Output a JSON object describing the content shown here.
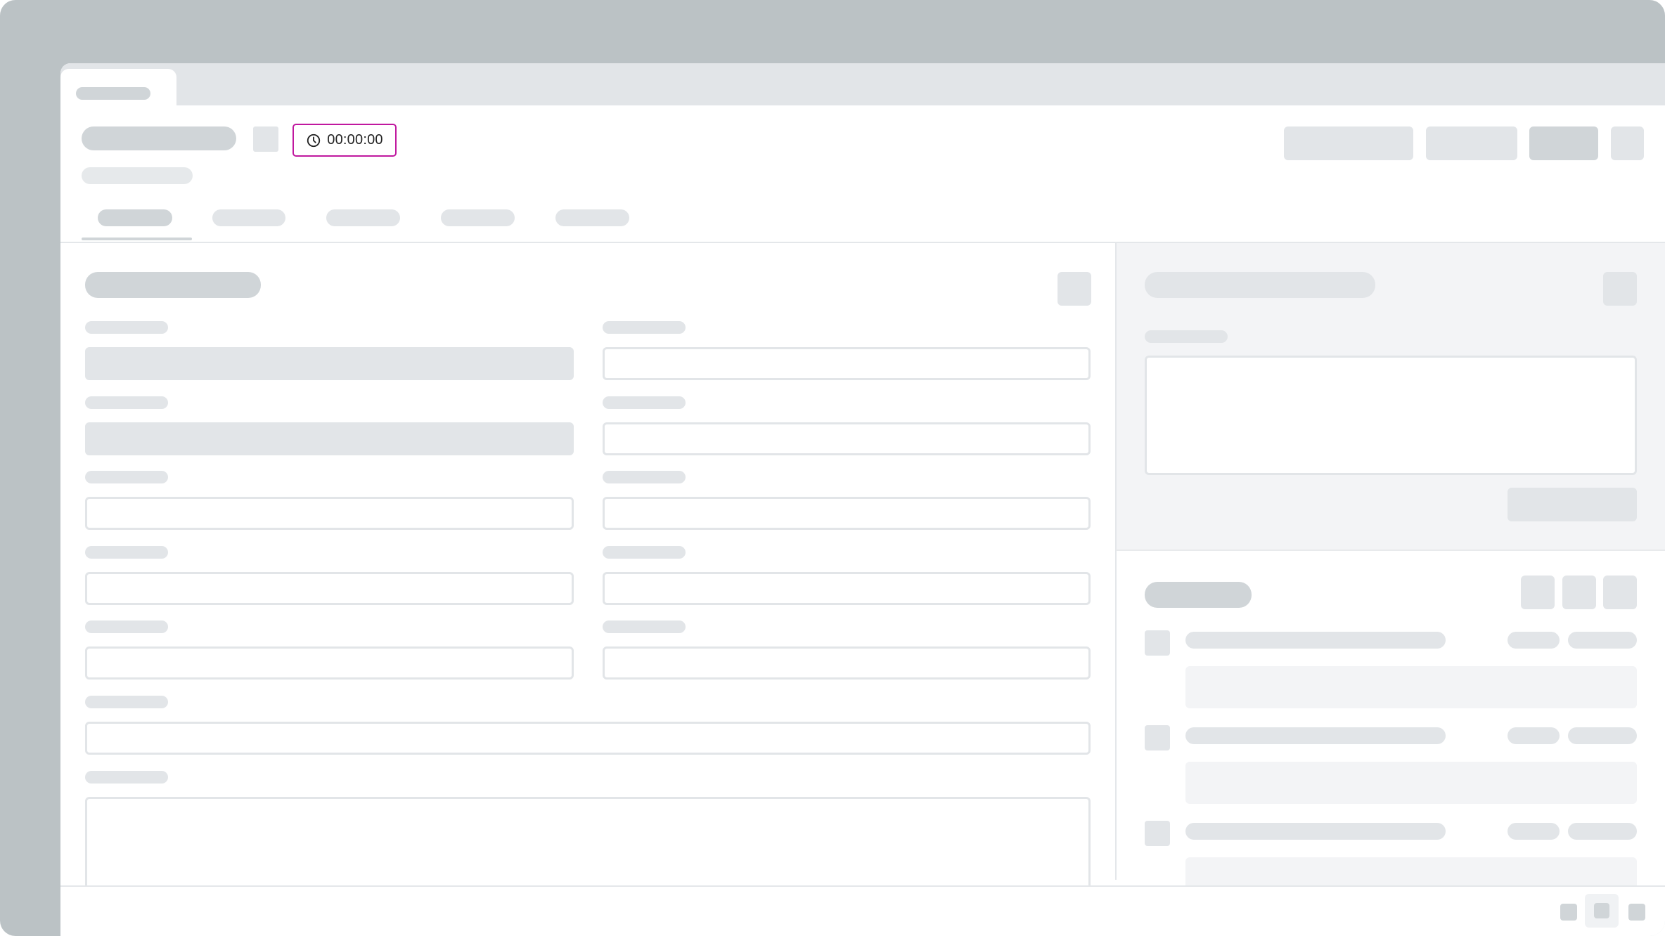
{
  "header": {
    "timer": {
      "value": "00:00:00",
      "icon": "clock-icon",
      "accent": "#c0189f"
    }
  },
  "colors": {
    "frame": "#bbc2c5",
    "skeleton": "#e2e5e8",
    "skeleton_dark": "#d0d5d8",
    "panel_bg": "#f3f4f6"
  }
}
